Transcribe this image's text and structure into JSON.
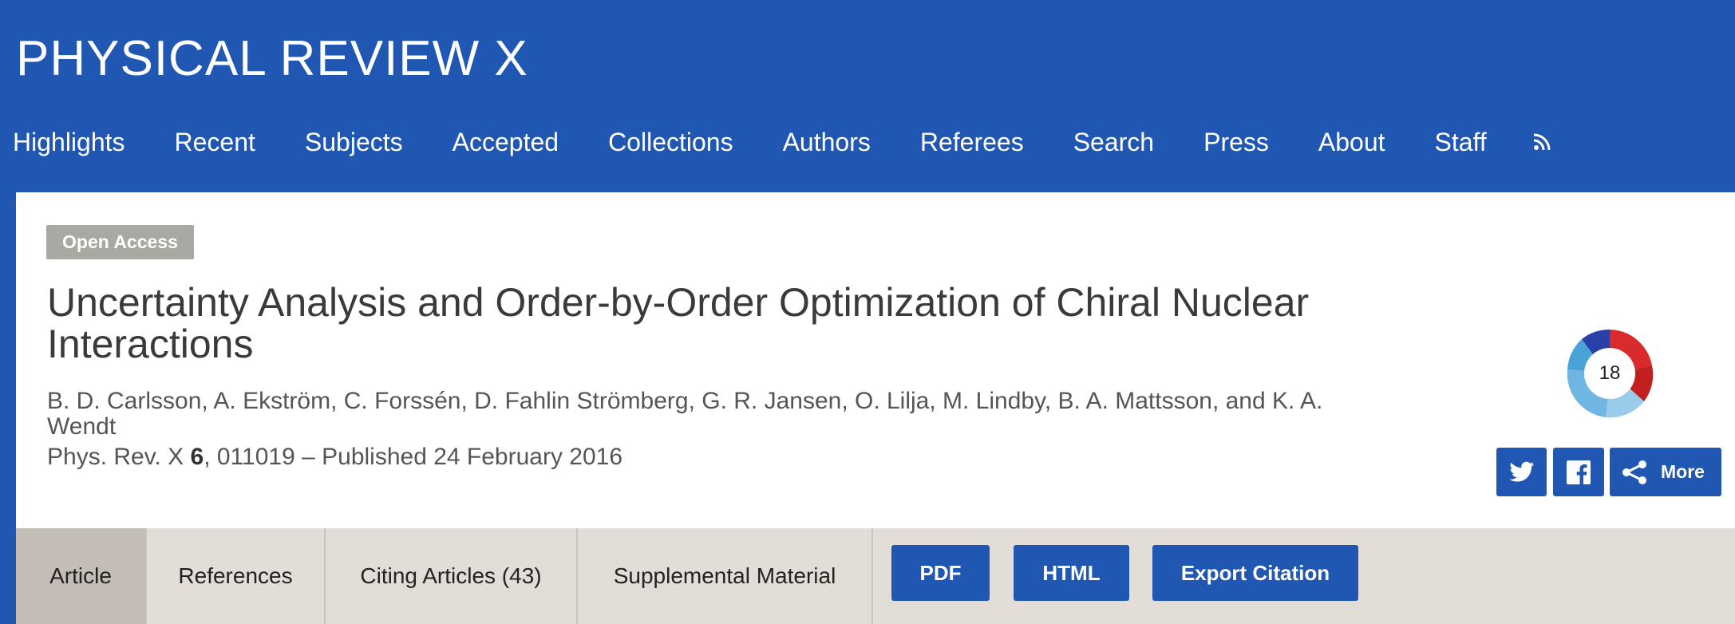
{
  "header": {
    "journal_title": "PHYSICAL REVIEW X",
    "nav": [
      {
        "label": "Highlights"
      },
      {
        "label": "Recent"
      },
      {
        "label": "Subjects"
      },
      {
        "label": "Accepted"
      },
      {
        "label": "Collections"
      },
      {
        "label": "Authors"
      },
      {
        "label": "Referees"
      },
      {
        "label": "Search"
      },
      {
        "label": "Press"
      },
      {
        "label": "About"
      },
      {
        "label": "Staff"
      }
    ],
    "rss_icon": "rss-icon"
  },
  "article": {
    "access_badge": "Open Access",
    "title": "Uncertainty Analysis and Order-by-Order Optimization of Chiral Nuclear Interactions",
    "authors": "B. D. Carlsson, A. Ekström, C. Forssén, D. Fahlin Strömberg, G. R. Jansen, O. Lilja, M. Lindby, B. A. Mattsson, and K. A. Wendt",
    "journal_abbrev": "Phys. Rev. X",
    "volume": "6",
    "article_number": ", 011019",
    "published": " – Published 24 February 2016"
  },
  "altmetric": {
    "score": "18"
  },
  "share": {
    "twitter_icon": "twitter-icon",
    "facebook_icon": "facebook-icon",
    "more_label": "More"
  },
  "tabs": [
    {
      "label": "Article",
      "active": true
    },
    {
      "label": "References"
    },
    {
      "label": "Citing Articles (43)"
    },
    {
      "label": "Supplemental Material"
    }
  ],
  "actions": {
    "pdf": "PDF",
    "html": "HTML",
    "export": "Export Citation"
  },
  "colors": {
    "brand_blue": "#2057b3",
    "badge_gray": "#a9a9a4",
    "tab_bg": "#e2ddd6",
    "tab_active": "#c4bdb5"
  }
}
